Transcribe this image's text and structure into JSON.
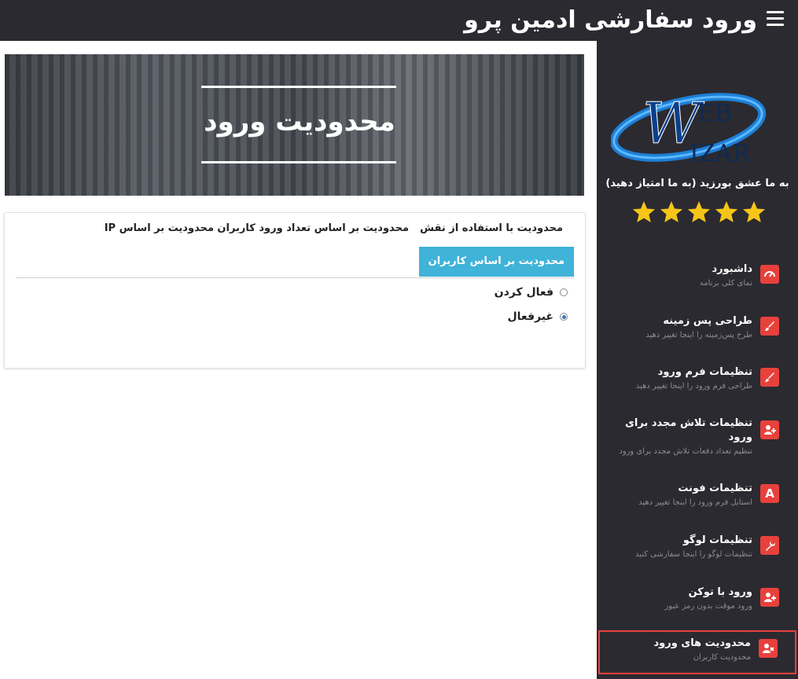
{
  "header": {
    "title": "ورود سفارشی ادمین پرو"
  },
  "sidebar": {
    "logo": {
      "line1": "EB",
      "line2": "IZAR"
    },
    "rate_text": "به ما عشق بورزید (به ما امتیاز دهید)",
    "star_count": 5,
    "items": [
      {
        "label": "داشبورد",
        "sub": "نمای کلی برنامه",
        "icon": "dashboard-icon"
      },
      {
        "label": "طراحی پس زمینه",
        "sub": "طرح پس‌زمینه را اینجا تغییر دهید",
        "icon": "brush-icon"
      },
      {
        "label": "تنظیمات فرم ورود",
        "sub": "طراحی فرم ورود را اینجا تغییر دهید",
        "icon": "brush-icon"
      },
      {
        "label": "تنظیمات تلاش مجدد برای ورود",
        "sub": "تنظیم تعداد دفعات تلاش مجدد برای ورود",
        "icon": "user-plus-icon"
      },
      {
        "label": "تنظیمات فونت",
        "sub": "استایل فرم ورود را اینجا تغییر دهید",
        "icon": "font-icon"
      },
      {
        "label": "تنظیمات لوگو",
        "sub": "تنظیمات لوگو را اینجا سفارشی کنید",
        "icon": "wrench-icon"
      },
      {
        "label": "ورود با توکن",
        "sub": "ورود موقت بدون رمز عبور",
        "icon": "user-plus-icon"
      },
      {
        "label": "محدودیت های ورود",
        "sub": "محدودیت کاربران",
        "icon": "user-x-icon"
      }
    ]
  },
  "hero": {
    "title": "محدودیت ورود"
  },
  "tabs": {
    "role": "محدودیت با استفاده از نقش",
    "count": "محدودیت بر اساس تعداد ورود کاربران",
    "ip": "محدودیت بر اساس IP",
    "user": "محدودیت بر اساس کاربران"
  },
  "options": {
    "enable": "فعال کردن",
    "disable": "غیرفعال",
    "selected": "disable"
  },
  "colors": {
    "accent": "#3fb3d8",
    "icon_red": "#e8413c",
    "dark": "#2b2a30",
    "star": "#f5c518"
  }
}
